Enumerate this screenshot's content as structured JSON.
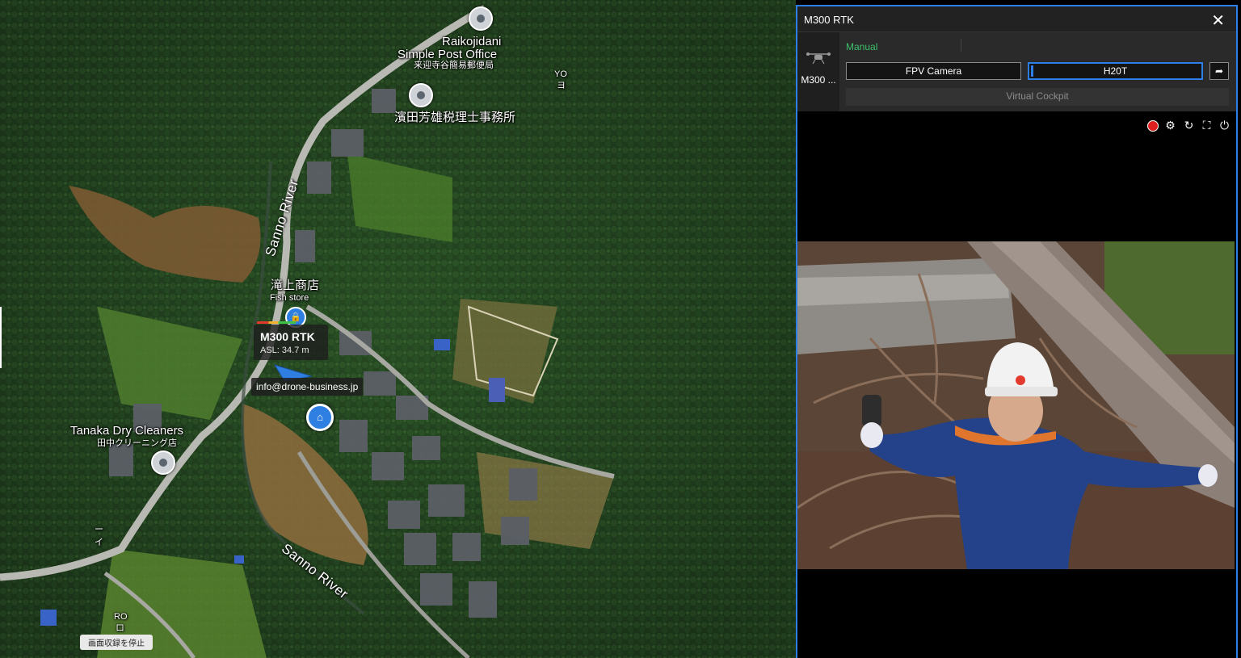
{
  "map": {
    "pois": [
      {
        "name_en": "Raikojidani",
        "name_en2": "Simple Post Office",
        "name_ja": "来迎寺谷簡易郵便局"
      },
      {
        "name_ja": "濱田芳雄税理士事務所"
      },
      {
        "name_ja": "滝上商店",
        "name_en": "Fish store"
      },
      {
        "name_en": "Tanaka Dry Cleaners",
        "name_ja": "田中クリーニング店"
      }
    ],
    "river_labels": [
      "Sanno River",
      "Sanno River"
    ],
    "area_marks": [
      "YO",
      "ヨ",
      "RO",
      "ロ",
      "イ",
      "ー"
    ],
    "drone": {
      "name": "M300 RTK",
      "asl": "ASL: 34.7 m"
    },
    "tooltip": "info@drone-business.jp",
    "stop_recording": "画面収録を停止"
  },
  "panel": {
    "title": "M300 RTK",
    "close_icon": "close-icon",
    "device_name": "M300 ...",
    "mode": "Manual",
    "buttons": {
      "fpv": "FPV Camera",
      "h20t": "H20T",
      "cockpit": "Virtual Cockpit"
    },
    "video_controls": [
      "record-icon",
      "settings-icon",
      "refresh-icon",
      "fullscreen-icon",
      "power-icon"
    ],
    "accent": "#2d7ee6",
    "mode_color": "#3cc06b",
    "record_color": "#e02020"
  }
}
